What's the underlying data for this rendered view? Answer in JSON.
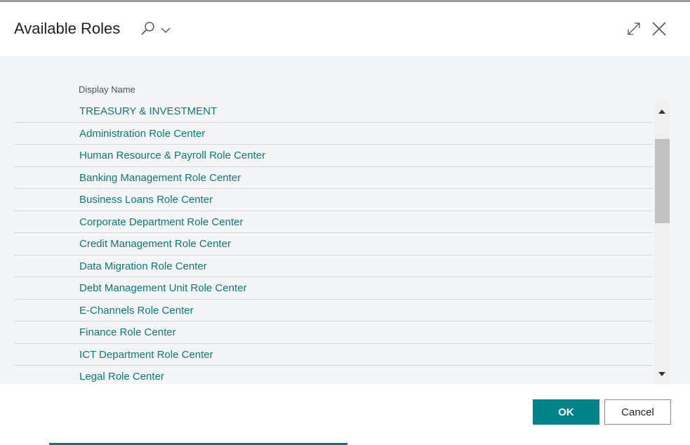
{
  "dialog": {
    "title": "Available Roles"
  },
  "table": {
    "column_header": "Display Name",
    "rows": [
      "TREASURY & INVESTMENT",
      "Administration Role Center",
      "Human Resource & Payroll Role Center",
      "Banking Management Role Center",
      "Business Loans Role Center",
      "Corporate Department Role Center",
      "Credit Management Role Center",
      "Data Migration Role Center",
      "Debt Management Unit Role Center",
      "E-Channels Role Center",
      "Finance Role Center",
      "ICT Department Role Center",
      "Legal Role Center"
    ]
  },
  "footer": {
    "ok_label": "OK",
    "cancel_label": "Cancel"
  },
  "icons": {
    "search": "search-icon",
    "dropdown": "chevron-down-icon",
    "expand": "expand-icon",
    "close": "close-icon",
    "scroll_up": "triangle-up-icon",
    "scroll_down": "triangle-down-icon"
  },
  "colors": {
    "accent": "#008489",
    "link": "#0a7a76",
    "list_background": "#f4f5f6"
  }
}
